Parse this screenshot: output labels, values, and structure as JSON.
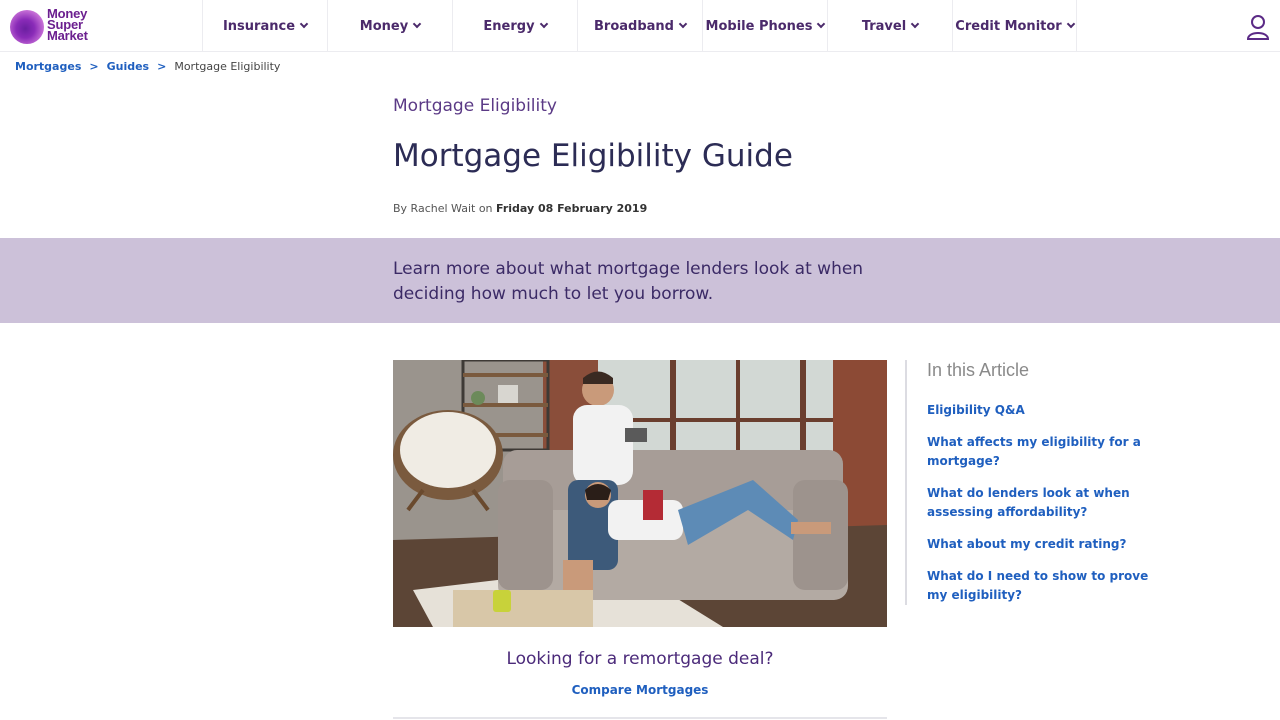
{
  "brand": {
    "logo_line1": "Money",
    "logo_line2": "Super",
    "logo_line3": "Market",
    "accent": "#6b1f8f"
  },
  "nav": {
    "items": [
      {
        "label": "Insurance"
      },
      {
        "label": "Money"
      },
      {
        "label": "Energy"
      },
      {
        "label": "Broadband"
      },
      {
        "label": "Mobile Phones"
      },
      {
        "label": "Travel"
      },
      {
        "label": "Credit Monitor"
      }
    ],
    "user_icon": "user-icon"
  },
  "breadcrumb": {
    "items": [
      {
        "label": "Mortgages"
      },
      {
        "label": "Guides"
      }
    ],
    "separator": ">",
    "current": "Mortgage Eligibility"
  },
  "article": {
    "kicker": "Mortgage Eligibility",
    "title": "Mortgage Eligibility Guide",
    "byline_prefix": "By Rachel Wait on",
    "date": "Friday 08 February 2019",
    "intro": "Learn more about what mortgage lenders look at when deciding how much to let you borrow.",
    "banner_color": "#ccc1d9"
  },
  "cta": {
    "question": "Looking for a remortgage deal?",
    "link": "Compare Mortgages"
  },
  "toc": {
    "title": "In this Article",
    "links": [
      {
        "label": "Eligibility Q&A"
      },
      {
        "label": "What affects my eligibility for a mortgage?"
      },
      {
        "label": "What do lenders look at when assessing affordability?"
      },
      {
        "label": "What about my credit rating?"
      },
      {
        "label": "What do I need to show to prove my eligibility?"
      }
    ]
  }
}
